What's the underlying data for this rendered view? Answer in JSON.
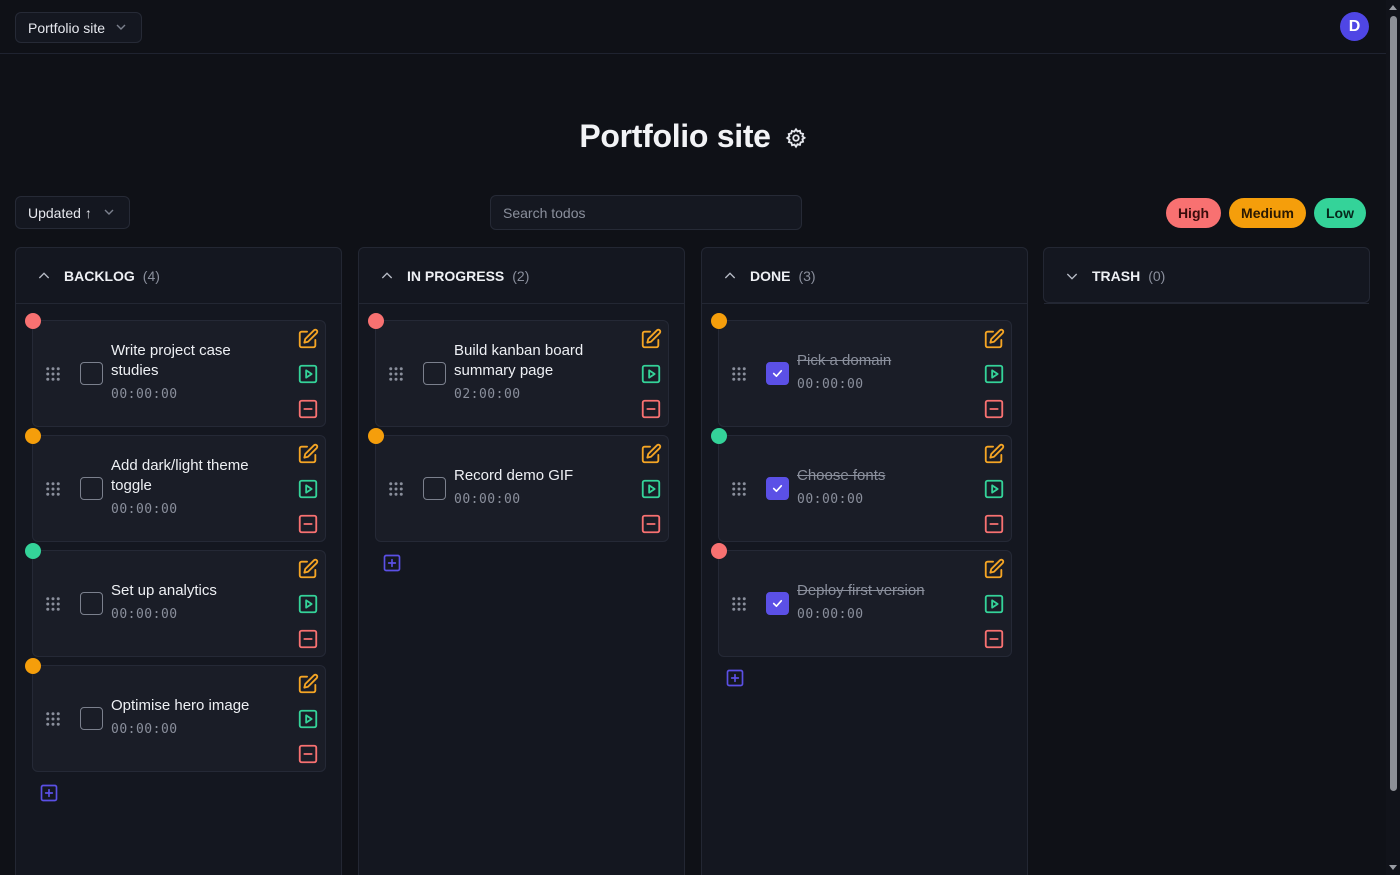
{
  "topbar": {
    "project_name": "Portfolio site",
    "avatar_initial": "D"
  },
  "page": {
    "title": "Portfolio site"
  },
  "toolbar": {
    "sort_label": "Updated ↑",
    "search_placeholder": "Search todos",
    "priority_filters": [
      "High",
      "Medium",
      "Low"
    ]
  },
  "colors": {
    "high": "#f87171",
    "medium": "#f59e0b",
    "low": "#34d399",
    "accent": "#5b50e6"
  },
  "columns": [
    {
      "name": "BACKLOG",
      "count": "(4)",
      "cards": [
        {
          "title": "Write project case studies",
          "timer": "00:00:00",
          "priority": "high",
          "done": false
        },
        {
          "title": "Add dark/light theme toggle",
          "timer": "00:00:00",
          "priority": "medium",
          "done": false
        },
        {
          "title": "Set up analytics",
          "timer": "00:00:00",
          "priority": "low",
          "done": false
        },
        {
          "title": "Optimise hero image",
          "timer": "00:00:00",
          "priority": "medium",
          "done": false
        }
      ]
    },
    {
      "name": "IN PROGRESS",
      "count": "(2)",
      "cards": [
        {
          "title": "Build kanban board summary page",
          "timer": "02:00:00",
          "priority": "high",
          "done": false
        },
        {
          "title": "Record demo GIF",
          "timer": "00:00:00",
          "priority": "medium",
          "done": false
        }
      ]
    },
    {
      "name": "DONE",
      "count": "(3)",
      "cards": [
        {
          "title": "Pick a domain",
          "timer": "00:00:00",
          "priority": "medium",
          "done": true
        },
        {
          "title": "Choose fonts",
          "timer": "00:00:00",
          "priority": "low",
          "done": true
        },
        {
          "title": "Deploy first version",
          "timer": "00:00:00",
          "priority": "high",
          "done": true
        }
      ]
    },
    {
      "name": "TRASH",
      "count": "(0)",
      "cards": []
    }
  ]
}
